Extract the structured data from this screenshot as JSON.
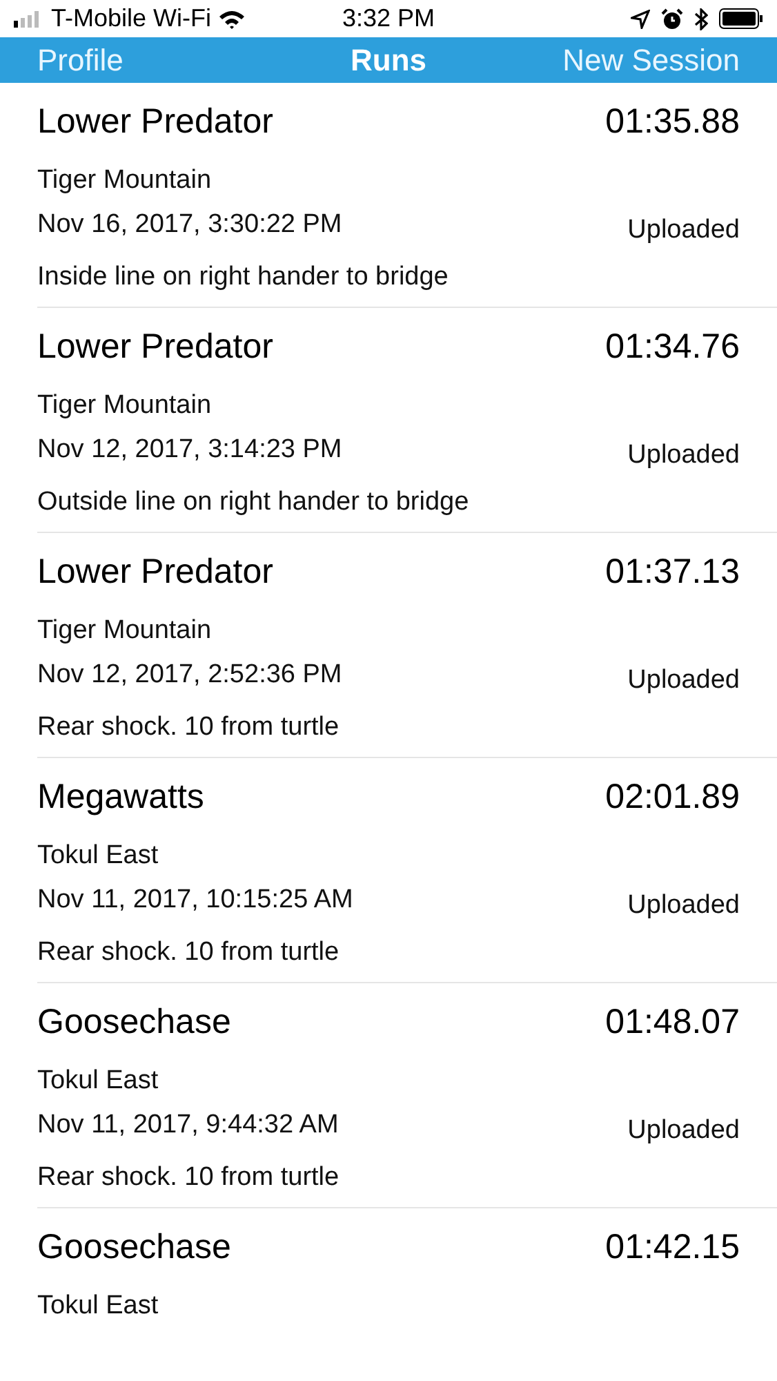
{
  "status_bar": {
    "carrier": "T-Mobile Wi-Fi",
    "time": "3:32 PM"
  },
  "nav_bar": {
    "left_button": "Profile",
    "title": "Runs",
    "right_button": "New Session"
  },
  "runs": [
    {
      "trail": "Lower Predator",
      "time": "01:35.88",
      "location": "Tiger Mountain",
      "date": "Nov 16, 2017, 3:30:22 PM",
      "status": "Uploaded",
      "note": "Inside line on right hander to bridge"
    },
    {
      "trail": "Lower Predator",
      "time": "01:34.76",
      "location": "Tiger Mountain",
      "date": "Nov 12, 2017, 3:14:23 PM",
      "status": "Uploaded",
      "note": "Outside line on right hander to bridge"
    },
    {
      "trail": "Lower Predator",
      "time": "01:37.13",
      "location": "Tiger Mountain",
      "date": "Nov 12, 2017, 2:52:36 PM",
      "status": "Uploaded",
      "note": "Rear shock. 10 from turtle"
    },
    {
      "trail": "Megawatts",
      "time": "02:01.89",
      "location": "Tokul East",
      "date": "Nov 11, 2017, 10:15:25 AM",
      "status": "Uploaded",
      "note": "Rear shock. 10 from turtle"
    },
    {
      "trail": "Goosechase",
      "time": "01:48.07",
      "location": "Tokul East",
      "date": "Nov 11, 2017, 9:44:32 AM",
      "status": "Uploaded",
      "note": "Rear shock. 10 from turtle"
    },
    {
      "trail": "Goosechase",
      "time": "01:42.15",
      "location": "Tokul East"
    }
  ]
}
